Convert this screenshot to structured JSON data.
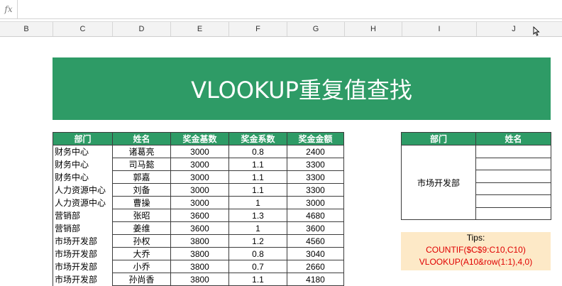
{
  "formula_bar": {
    "fx_label": "fx",
    "value": ""
  },
  "columns": [
    "B",
    "C",
    "D",
    "E",
    "F",
    "G",
    "H",
    "I",
    "J"
  ],
  "title": "VLOOKUP重复值查找",
  "main_table": {
    "headers": [
      "部门",
      "姓名",
      "奖金基数",
      "奖金系数",
      "奖金金额"
    ],
    "rows": [
      [
        "财务中心",
        "诸葛亮",
        "3000",
        "0.8",
        "2400"
      ],
      [
        "财务中心",
        "司马懿",
        "3000",
        "1.1",
        "3300"
      ],
      [
        "财务中心",
        "郭嘉",
        "3000",
        "1.1",
        "3300"
      ],
      [
        "人力资源中心",
        "刘备",
        "3000",
        "1.1",
        "3300"
      ],
      [
        "人力资源中心",
        "曹操",
        "3000",
        "1",
        "3000"
      ],
      [
        "营销部",
        "张昭",
        "3600",
        "1.3",
        "4680"
      ],
      [
        "营销部",
        "姜维",
        "3600",
        "1",
        "3600"
      ],
      [
        "市场开发部",
        "孙权",
        "3800",
        "1.2",
        "4560"
      ],
      [
        "市场开发部",
        "大乔",
        "3800",
        "0.8",
        "3040"
      ],
      [
        "市场开发部",
        "小乔",
        "3800",
        "0.7",
        "2660"
      ],
      [
        "市场开发部",
        "孙尚香",
        "3800",
        "1.1",
        "4180"
      ]
    ]
  },
  "lookup_table": {
    "headers": [
      "部门",
      "姓名"
    ],
    "dept_value": "市场开发部",
    "names": [
      "",
      "",
      "",
      "",
      ""
    ]
  },
  "tips": {
    "title": "Tips:",
    "formula1": "COUNTIF($C$9:C10,C10)",
    "formula2": "VLOOKUP(A10&row(1:1),4,0)"
  },
  "colors": {
    "header_green": "#2e9b66",
    "tips_bg": "#fde9c7",
    "formula_red": "#e00000"
  }
}
